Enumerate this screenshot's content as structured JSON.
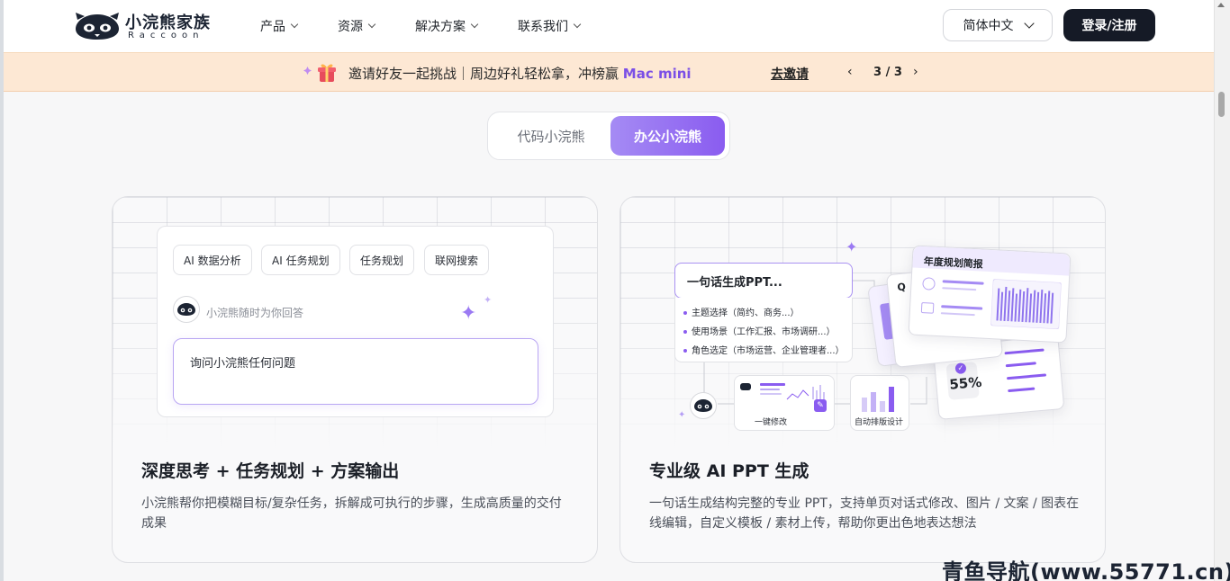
{
  "brand": {
    "name": "小浣熊家族",
    "sub": "Raccoon"
  },
  "nav": [
    {
      "label": "产品"
    },
    {
      "label": "资源"
    },
    {
      "label": "解决方案"
    },
    {
      "label": "联系我们"
    }
  ],
  "header": {
    "language": "简体中文",
    "login": "登录/注册"
  },
  "banner": {
    "text": "邀请好友一起挑战｜周边好礼轻松拿，冲榜赢 ",
    "highlight": "Mac mini",
    "link": "去邀请",
    "prev": "‹",
    "next": "›",
    "page": "3 / 3"
  },
  "tabs": [
    {
      "label": "代码小浣熊",
      "active": false
    },
    {
      "label": "办公小浣熊",
      "active": true
    }
  ],
  "cards": [
    {
      "title": "深度思考 + 任务规划 + 方案输出",
      "desc": "小浣熊帮你把模糊目标/复杂任务，拆解成可执行的步骤，生成高质量的交付成果",
      "chips": [
        "AI 数据分析",
        "AI 任务规划",
        "任务规划",
        "联网搜索"
      ],
      "hint": "小浣熊随时为你回答",
      "input_placeholder": "询问小浣熊任何问题"
    },
    {
      "title": "专业级 AI PPT 生成",
      "desc": "一句话生成结构完整的专业 PPT，支持单页对话式修改、图片 / 文案 / 图表在线编辑，自定义模板 / 素材上传，帮助你更出色地表达想法",
      "prompt": "一句话生成PPT...",
      "options": [
        "主题选择（简约、商务...）",
        "使用场景（工作汇报、市场调研...）",
        "角色选定（市场运营、企业管理者...）"
      ],
      "edit_label": "一键修改",
      "layout_label": "自动排版设计",
      "slide_title": "年度规划简报",
      "slide_q": "Q",
      "percent": "55%"
    }
  ],
  "watermark": "青鱼导航(www.55771.cn)",
  "colors": {
    "accent": "#8a5cf0",
    "banner_bg": "#fde8d4",
    "login_bg": "#151a26"
  }
}
